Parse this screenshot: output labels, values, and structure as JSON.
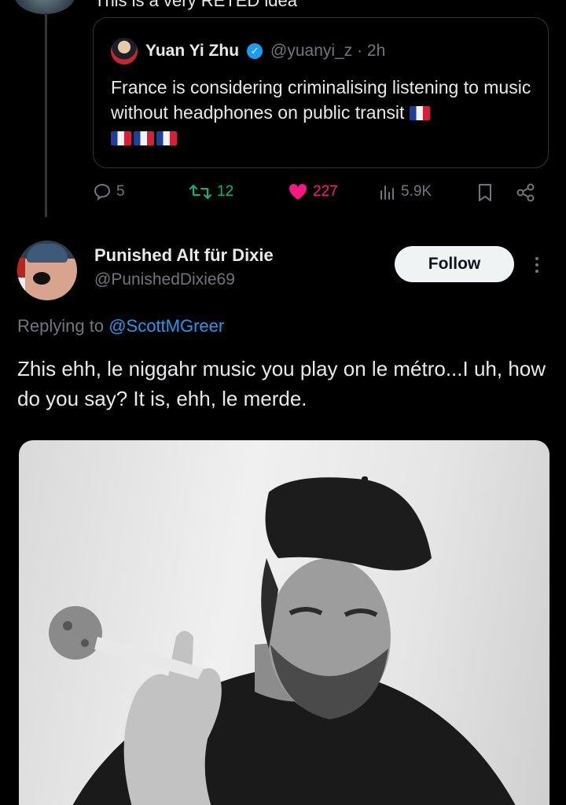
{
  "top_partial": {
    "text": "This is a very RETED idea"
  },
  "quoted_tweet": {
    "author_name": "Yuan Yi Zhu",
    "handle_time": "@yuanyi_z · 2h",
    "text": "France is considering criminalising listening to music without headphones on public transit"
  },
  "actions": {
    "replies": "5",
    "retweets": "12",
    "likes": "227",
    "views": "5.9K",
    "like_color": "#f91880",
    "retweet_color": "#00ba7c"
  },
  "reply": {
    "author_name": "Punished Alt für Dixie",
    "handle": "@PunishedDixie69",
    "follow_label": "Follow",
    "replying_prefix": "Replying to",
    "replying_mention": "@ScottMGreer",
    "text": "Zhis ehh, le niggahr music you play on le métro...I uh, how do you say? It is, ehh, le merde."
  },
  "colors": {
    "background": "#000000",
    "text": "#e7e9ea",
    "muted": "#71767b",
    "link": "#1d9bf0",
    "verified": "#1d9bf0"
  }
}
